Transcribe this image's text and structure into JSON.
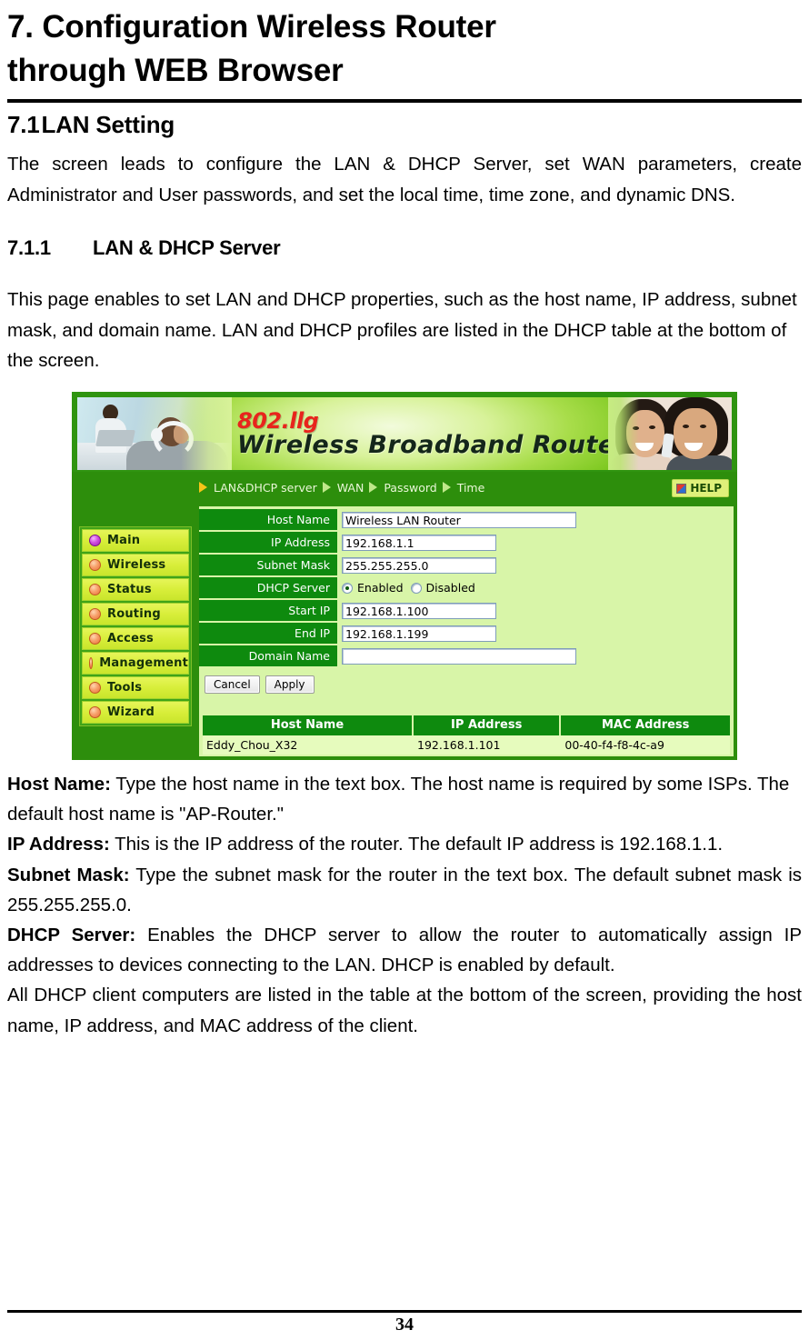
{
  "document": {
    "title_line1": "7. Configuration",
    "title_line1_word2": "Wireless",
    "title_line1_word3": "Router",
    "title_line2": "through WEB Browser",
    "section": {
      "number": "7.1",
      "name": "LAN Setting",
      "intro": "The screen leads to configure the LAN & DHCP Server, set WAN parameters, create Administrator and User passwords, and set the local time, time zone, and dynamic DNS."
    },
    "subsection": {
      "number": "7.1.1",
      "name": "LAN & DHCP Server",
      "intro": "This page enables to set LAN and DHCP properties, such as the host name, IP address, subnet mask, and domain name. LAN and DHCP profiles are listed in the DHCP table at the bottom of the screen."
    },
    "descriptions": [
      {
        "term": "Host Name:",
        "text": " Type the host name in the text box. The host name is required by some ISPs. The default host name is \"AP-Router.\""
      },
      {
        "term": "IP Address:",
        "text": " This is the IP address of the router. The default IP address is 192.168.1.1."
      },
      {
        "term": "Subnet Mask:",
        "text": " Type the subnet mask for the router in the text box. The default subnet mask is 255.255.255.0."
      },
      {
        "term": "DHCP Server:",
        "text": " Enables the DHCP server to allow the router to automatically assign IP addresses to devices connecting to the LAN. DHCP is enabled by default."
      }
    ],
    "closing_paragraph": "All DHCP client computers are listed in the table at the bottom of the screen, providing the host name, IP address, and MAC address of the client.",
    "page_number": "34"
  },
  "router_ui": {
    "banner": {
      "standard": "802.llg",
      "product": "Wireless  Broadband  Router"
    },
    "nav": {
      "items": [
        {
          "label": "LAN&DHCP server",
          "active": true
        },
        {
          "label": "WAN",
          "active": false
        },
        {
          "label": "Password",
          "active": false
        },
        {
          "label": "Time",
          "active": false
        }
      ],
      "help_label": "HELP"
    },
    "sidebar": {
      "items": [
        {
          "label": "Main",
          "selected": true
        },
        {
          "label": "Wireless",
          "selected": false
        },
        {
          "label": "Status",
          "selected": false
        },
        {
          "label": "Routing",
          "selected": false
        },
        {
          "label": "Access",
          "selected": false
        },
        {
          "label": "Management",
          "selected": false
        },
        {
          "label": "Tools",
          "selected": false
        },
        {
          "label": "Wizard",
          "selected": false
        }
      ]
    },
    "form": {
      "host_name": {
        "label": "Host Name",
        "value": "Wireless LAN Router"
      },
      "ip_address": {
        "label": "IP Address",
        "value": "192.168.1.1"
      },
      "subnet_mask": {
        "label": "Subnet Mask",
        "value": "255.255.255.0"
      },
      "dhcp_server": {
        "label": "DHCP Server",
        "enabled_label": "Enabled",
        "disabled_label": "Disabled",
        "selected": "Enabled"
      },
      "start_ip": {
        "label": "Start IP",
        "value": "192.168.1.100"
      },
      "end_ip": {
        "label": "End IP",
        "value": "192.168.1.199"
      },
      "domain_name": {
        "label": "Domain Name",
        "value": ""
      },
      "cancel_label": "Cancel",
      "apply_label": "Apply"
    },
    "dhcp_table": {
      "headers": [
        "Host Name",
        "IP Address",
        "MAC Address"
      ],
      "rows": [
        {
          "host": "Eddy_Chou_X32",
          "ip": "192.168.1.101",
          "mac": "00-40-f4-f8-4c-a9"
        }
      ]
    },
    "colors": {
      "dark_green": "#2d8e0c",
      "label_green": "#0e8a0e",
      "content_green": "#d8f5a8",
      "menu_yellow": "#d8ee3a",
      "brand_red": "#e8241c"
    }
  }
}
